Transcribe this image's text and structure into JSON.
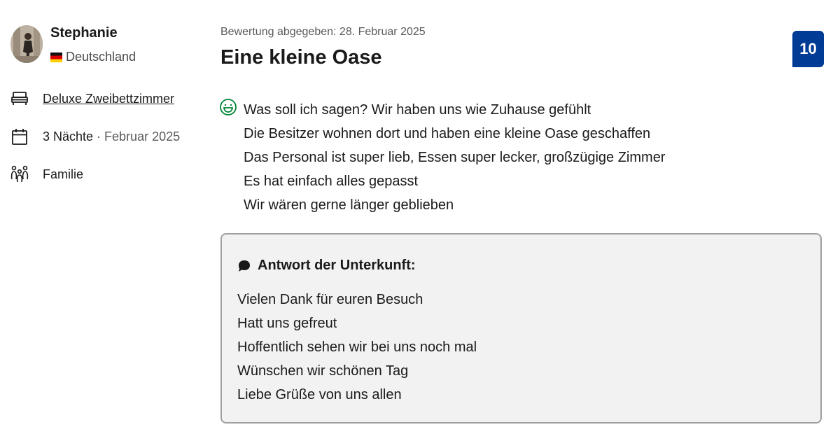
{
  "reviewer": {
    "name": "Stephanie",
    "country": "Deutschland",
    "avatar_icon": "reviewer-avatar-photo",
    "flag_icon": "germany-flag-icon"
  },
  "stay_info": {
    "room": "Deluxe Zweibettzimmer",
    "nights": "3 Nächte",
    "separator": " · ",
    "month": "Februar 2025",
    "traveler_type": "Familie",
    "icons": {
      "room": "bed-icon",
      "stay": "calendar-icon",
      "traveler_type": "family-icon"
    }
  },
  "review": {
    "date_text": "Bewertung abgegeben: 28. Februar 2025",
    "title": "Eine kleine Oase",
    "score": "10",
    "positive_icon": "smiley-icon",
    "positive_lines": [
      "Was soll ich sagen? Wir haben uns wie Zuhause gefühlt",
      "Die Besitzer wohnen dort und haben eine kleine Oase geschaffen",
      "Das Personal ist super lieb, Essen super lecker, großzügige Zimmer",
      "Es hat einfach alles gepasst",
      "Wir wären gerne länger geblieben"
    ]
  },
  "response": {
    "icon": "speech-bubble-icon",
    "title": "Antwort der Unterkunft:",
    "lines": [
      "Vielen Dank für euren Besuch",
      "Hatt uns gefreut",
      "Hoffentlich sehen wir bei uns noch mal",
      "Wünschen wir schönen Tag",
      "Liebe Grüße von uns allen"
    ]
  },
  "colors": {
    "score_badge": "#003b95",
    "positive_icon": "#008234",
    "response_background": "#f2f2f2",
    "response_border": "#9e9e9e"
  }
}
